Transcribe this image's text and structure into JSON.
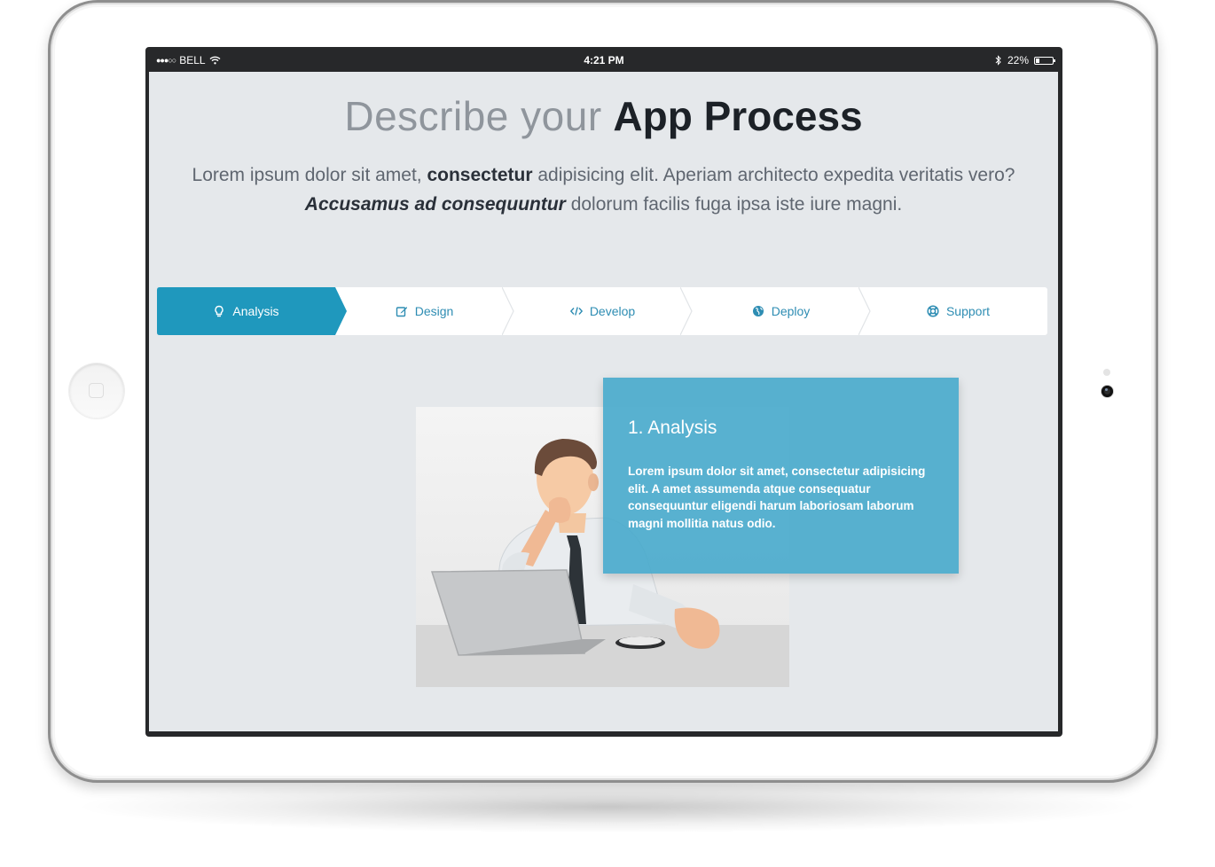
{
  "status_bar": {
    "carrier": "BELL",
    "time": "4:21 PM",
    "battery": "22%",
    "battery_level": 0.22
  },
  "header": {
    "title_light": "Describe your",
    "title_bold": "App Process",
    "intro": {
      "part1": "Lorem ipsum dolor sit amet, ",
      "bold1": "consectetur",
      "part2": " adipisicing elit. Aperiam architecto expedita veritatis vero?",
      "bold_italic": "Accusamus ad consequuntur",
      "part3": " dolorum facilis fuga ipsa iste iure magni."
    }
  },
  "steps": {
    "active_index": 0,
    "accent_color": "#1f98bd",
    "items": [
      {
        "label": "Analysis",
        "icon": "lightbulb-icon"
      },
      {
        "label": "Design",
        "icon": "edit-icon"
      },
      {
        "label": "Develop",
        "icon": "code-icon"
      },
      {
        "label": "Deploy",
        "icon": "globe-icon"
      },
      {
        "label": "Support",
        "icon": "lifebuoy-icon"
      }
    ]
  },
  "detail": {
    "title": "1. Analysis",
    "text": "Lorem ipsum dolor sit amet, consectetur adipisicing elit. A amet assumenda atque consequatur consequuntur eligendi harum laboriosam laborum magni mollitia natus odio."
  }
}
